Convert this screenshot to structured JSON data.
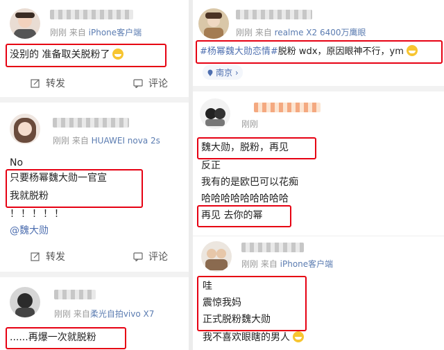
{
  "left": {
    "post1": {
      "meta_prefix": "刚刚  来自 ",
      "meta_source": "iPhone客户端",
      "text": "没别的 准备取关脱粉了",
      "repost": "转发",
      "comment": "评论"
    },
    "post2": {
      "meta_prefix": "刚刚  来自 ",
      "meta_source": "HUAWEI nova 2s",
      "lines": [
        "No",
        "只要杨幂魏大勋一官宣",
        "我就脱粉",
        "！！！！！",
        "@魏大勋"
      ],
      "repost": "转发",
      "comment": "评论"
    },
    "post3": {
      "meta_prefix": "刚刚  来自",
      "meta_source": "柔光自拍vivo X7",
      "text": "......再爆一次就脱粉"
    }
  },
  "right": {
    "post1": {
      "meta_prefix": "刚刚  来自 ",
      "meta_source": "realme X2 6400万鹰眼",
      "text_hashtag": "#杨幂魏大勋恋情#",
      "text_rest": "脱粉 wdx，原因眼神不行，ym",
      "location": "南京"
    },
    "post2": {
      "meta": "刚刚",
      "lines": [
        "魏大勋，脱粉，再见",
        "反正",
        "我有的是欧巴可以花痴",
        "哈哈哈哈哈哈哈哈哈",
        "再见 去你的幂"
      ]
    },
    "post3": {
      "meta_prefix": "刚刚  来自 ",
      "meta_source": "iPhone客户端",
      "lines": [
        "哇",
        "震惊我妈",
        "正式脱粉魏大勋",
        "我不喜欢眼瞎的男人"
      ]
    }
  },
  "colors": {
    "highlight_box": "#e60012",
    "link": "#4e6fb0"
  }
}
